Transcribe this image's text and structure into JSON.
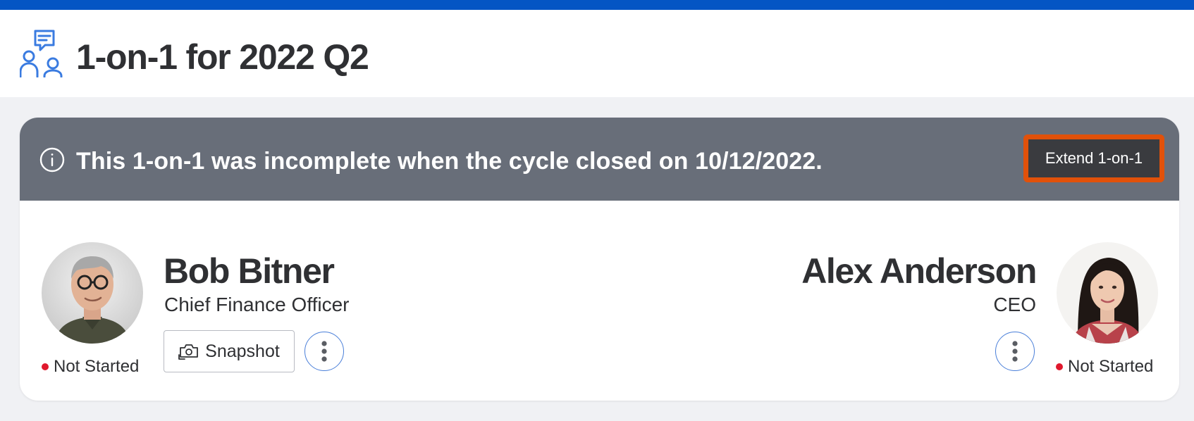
{
  "header": {
    "title": "1-on-1 for 2022 Q2",
    "icon": "one-on-one-people-chat-icon"
  },
  "banner": {
    "icon": "info-icon",
    "message": "This 1-on-1 was incomplete when the cycle closed on 10/12/2022.",
    "extend_button": "Extend 1-on-1"
  },
  "participants": {
    "left": {
      "name": "Bob Bitner",
      "role": "Chief Finance Officer",
      "status": "Not Started",
      "snapshot_label": "Snapshot",
      "more_icon": "kebab-menu-icon"
    },
    "right": {
      "name": "Alex Anderson",
      "role": "CEO",
      "status": "Not Started",
      "more_icon": "kebab-menu-icon"
    }
  },
  "colors": {
    "top_strip": "#0455c4",
    "banner_bg": "#686e79",
    "extend_button_bg": "#3a3b3f",
    "extend_button_border": "#e1510a",
    "status_dot": "#e0182d",
    "icon_blue": "#3a7be0"
  }
}
